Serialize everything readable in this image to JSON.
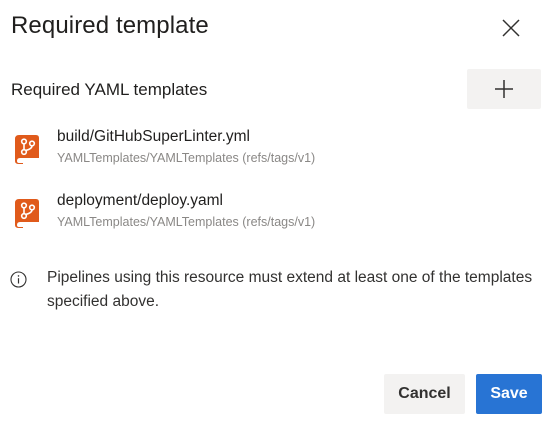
{
  "dialog": {
    "title": "Required template",
    "close_icon": "close-icon"
  },
  "section": {
    "title": "Required YAML templates",
    "add_icon": "plus-icon"
  },
  "templates": [
    {
      "name": "build/GitHubSuperLinter.yml",
      "ref": "YAMLTemplates/YAMLTemplates (refs/tags/v1)",
      "icon": "git-repo-icon"
    },
    {
      "name": "deployment/deploy.yaml",
      "ref": "YAMLTemplates/YAMLTemplates (refs/tags/v1)",
      "icon": "git-repo-icon"
    }
  ],
  "info": {
    "icon": "info-icon",
    "text": "Pipelines using this resource must extend at least one of the templates specified above."
  },
  "footer": {
    "cancel_label": "Cancel",
    "save_label": "Save"
  },
  "colors": {
    "accent": "#2874d4",
    "repo_icon": "#e05a1b",
    "neutral_button": "#f3f2f1",
    "secondary_text": "#8a8886"
  }
}
